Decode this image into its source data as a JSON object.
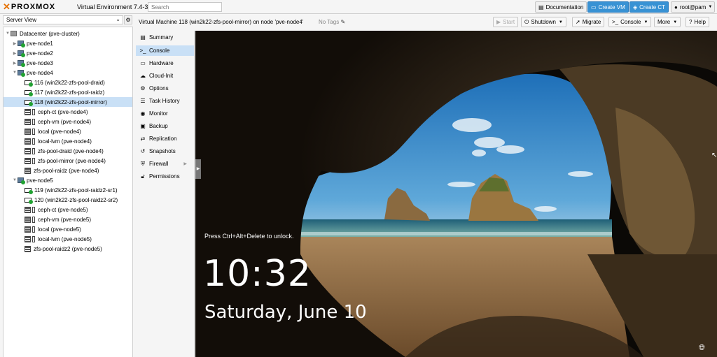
{
  "topbar": {
    "logo_x": "✕",
    "logo_name": "PROXMOX",
    "version": "Virtual Environment 7.4-3",
    "search_placeholder": "Search",
    "documentation": "Documentation",
    "create_vm": "Create VM",
    "create_ct": "Create CT",
    "user": "root@pam"
  },
  "tree": {
    "view": "Server View",
    "rows": [
      {
        "label": "Datacenter (pve-cluster)"
      },
      {
        "label": "pve-node1"
      },
      {
        "label": "pve-node2"
      },
      {
        "label": "pve-node3"
      },
      {
        "label": "pve-node4"
      },
      {
        "label": "116 (win2k22-zfs-pool-draid)"
      },
      {
        "label": "117 (win2k22-zfs-pool-raidz)"
      },
      {
        "label": "118 (win2k22-zfs-pool-mirror)"
      },
      {
        "label": "ceph-ct (pve-node4)"
      },
      {
        "label": "ceph-vm (pve-node4)"
      },
      {
        "label": "local (pve-node4)"
      },
      {
        "label": "local-lvm (pve-node4)"
      },
      {
        "label": "zfs-pool-draid (pve-node4)"
      },
      {
        "label": "zfs-pool-mirror (pve-node4)"
      },
      {
        "label": "zfs-pool-raidz (pve-node4)"
      },
      {
        "label": "pve-node5"
      },
      {
        "label": "119 (win2k22-zfs-pool-raidz2-sr1)"
      },
      {
        "label": "120 (win2k22-zfs-pool-raidz2-sr2)"
      },
      {
        "label": "ceph-ct (pve-node5)"
      },
      {
        "label": "ceph-vm (pve-node5)"
      },
      {
        "label": "local (pve-node5)"
      },
      {
        "label": "local-lvm (pve-node5)"
      },
      {
        "label": "zfs-pool-raidz2 (pve-node5)"
      }
    ]
  },
  "header": {
    "title": "Virtual Machine 118 (win2k22-zfs-pool-mirror) on node 'pve-node4'",
    "tags": "No Tags",
    "start": "Start",
    "shutdown": "Shutdown",
    "migrate": "Migrate",
    "console": "Console",
    "more": "More",
    "help": "Help"
  },
  "menu": [
    {
      "label": "Summary"
    },
    {
      "label": "Console"
    },
    {
      "label": "Hardware"
    },
    {
      "label": "Cloud-Init"
    },
    {
      "label": "Options"
    },
    {
      "label": "Task History"
    },
    {
      "label": "Monitor"
    },
    {
      "label": "Backup"
    },
    {
      "label": "Replication"
    },
    {
      "label": "Snapshots"
    },
    {
      "label": "Firewall"
    },
    {
      "label": "Permissions"
    }
  ],
  "console": {
    "unlock_text": "Press Ctrl+Alt+Delete to unlock.",
    "time": "10:32",
    "date": "Saturday, June 10"
  },
  "colors": {
    "accent": "#3892d4",
    "brand": "#e57000",
    "selection": "#c9e0f6",
    "status_running": "#21a132"
  }
}
